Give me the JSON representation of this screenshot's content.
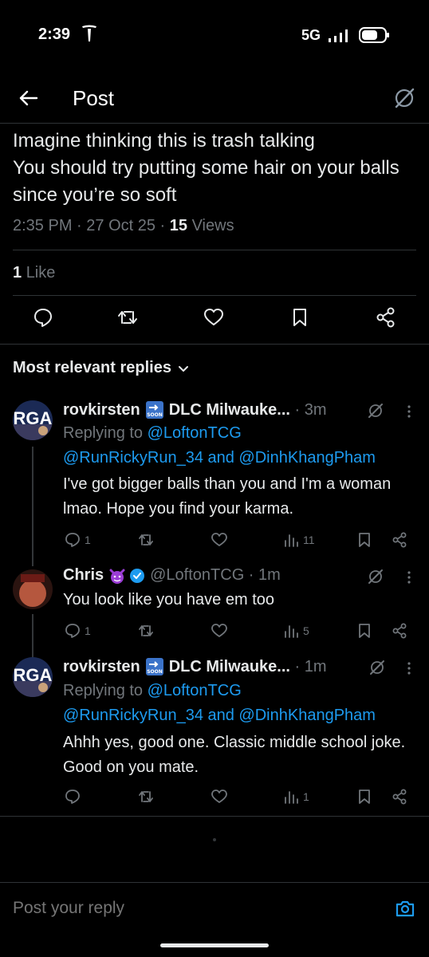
{
  "status_bar": {
    "time": "2:39",
    "network": "5G"
  },
  "header": {
    "title": "Post"
  },
  "post": {
    "text": "Imagine thinking this is trash talking\nYou should try putting some hair on your balls since you’re so soft",
    "time": "2:35 PM",
    "date": "27 Oct 25",
    "views_count": "15",
    "views_label": "Views",
    "likes_count": "1",
    "likes_label": "Like"
  },
  "sort": {
    "label": "Most relevant replies"
  },
  "replies": [
    {
      "name": "rovkirsten",
      "name_suffix": "DLC Milwauke...",
      "time": "3m",
      "replying_label": "Replying to",
      "replying_handle": "@LoftonTCG",
      "mentions": "@RunRickyRun_34 and @DinhKhangPham",
      "text": "I've got bigger balls than you and I'm a woman lmao. Hope you find your karma.",
      "reply_count": "1",
      "view_count": "11"
    },
    {
      "name": "Chris",
      "handle": "@LoftonTCG",
      "time": "1m",
      "text": "You look like you have em too",
      "reply_count": "1",
      "view_count": "5"
    },
    {
      "name": "rovkirsten",
      "name_suffix": "DLC Milwauke...",
      "time": "1m",
      "replying_label": "Replying to",
      "replying_handle": "@LoftonTCG",
      "mentions": "@RunRickyRun_34 and @DinhKhangPham",
      "text": "Ahhh yes, good one. Classic middle school joke.  Good on you mate.",
      "view_count": "1"
    }
  ],
  "reply_bar": {
    "placeholder": "Post your reply"
  },
  "colors": {
    "accent": "#1d9bf0",
    "muted": "#71767b",
    "divider": "#2f3336",
    "background": "#000000"
  }
}
